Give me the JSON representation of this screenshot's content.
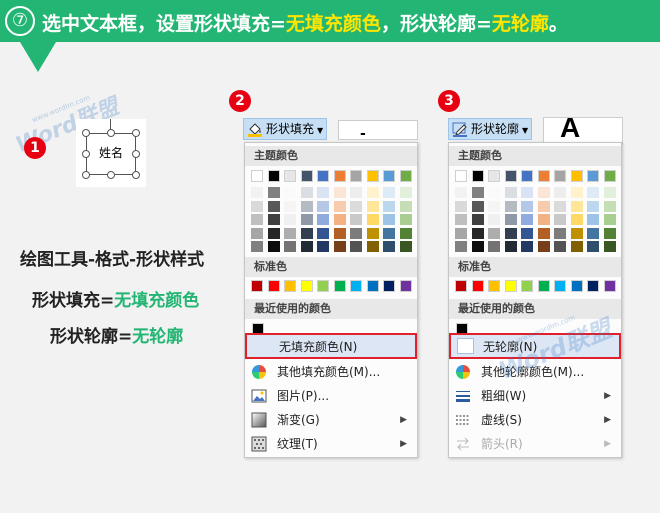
{
  "banner": {
    "step": "⑦",
    "text_part1": "选中文本框，设置形状填充=",
    "text_hl1": "无填充颜色",
    "text_part2": "，形状轮廓=",
    "text_hl2": "无轮廓",
    "text_end": "。",
    "color": "#22b573",
    "highlight_color": "#ffe600"
  },
  "watermark": {
    "word1": "Word",
    "word2": "联盟",
    "url": "www.wordlm.com"
  },
  "badges": [
    "1",
    "2",
    "3"
  ],
  "sample_textbox": {
    "text": "姓名"
  },
  "left_labels": {
    "line1": "绘图工具-格式-形状样式",
    "line2_prefix": "形状填充=",
    "line2_value": "无填充颜色",
    "line3_prefix": "形状轮廓=",
    "line3_value": "无轮廓"
  },
  "fill_menu": {
    "button_label": "形状填充",
    "theme_colors_label": "主题颜色",
    "standard_colors_label": "标准色",
    "recent_colors_label": "最近使用的颜色",
    "items": [
      {
        "label": "无填充颜色(N)",
        "icon": "no-fill-icon",
        "highlight": true
      },
      {
        "label": "其他填充颜色(M)...",
        "icon": "color-wheel-icon"
      },
      {
        "label": "图片(P)...",
        "icon": "picture-icon"
      },
      {
        "label": "渐变(G)",
        "icon": "gradient-icon",
        "submenu": true
      },
      {
        "label": "纹理(T)",
        "icon": "texture-icon",
        "submenu": true
      }
    ]
  },
  "outline_menu": {
    "button_label": "形状轮廓",
    "theme_colors_label": "主题颜色",
    "standard_colors_label": "标准色",
    "recent_colors_label": "最近使用的颜色",
    "items": [
      {
        "label": "无轮廓(N)",
        "icon": "no-outline-icon",
        "highlight": true
      },
      {
        "label": "其他轮廓颜色(M)...",
        "icon": "color-wheel-icon"
      },
      {
        "label": "粗细(W)",
        "icon": "line-weight-icon",
        "submenu": true
      },
      {
        "label": "虚线(S)",
        "icon": "dashes-icon",
        "submenu": true
      },
      {
        "label": "箭头(R)",
        "icon": "arrows-icon",
        "submenu": true,
        "disabled": true
      }
    ]
  },
  "gallery_glyph": "A",
  "palette": {
    "theme": [
      "#ffffff",
      "#000000",
      "#e7e6e6",
      "#44546a",
      "#4472c4",
      "#ed7d31",
      "#a5a5a5",
      "#ffc000",
      "#5b9bd5",
      "#70ad47"
    ],
    "standard": [
      "#c00000",
      "#ff0000",
      "#ffc000",
      "#ffff00",
      "#92d050",
      "#00b050",
      "#00b0f0",
      "#0070c0",
      "#002060",
      "#7030a0"
    ],
    "recent": [
      "#000000"
    ]
  }
}
